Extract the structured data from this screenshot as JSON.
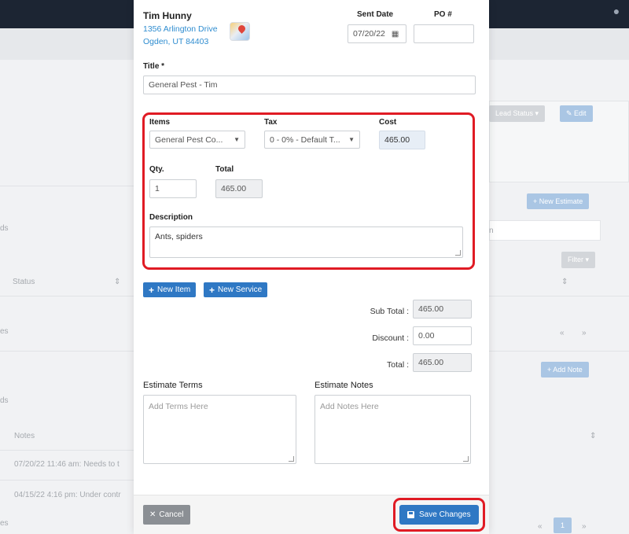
{
  "background": {
    "status_button": "Lead Status",
    "edit_button": "Edit",
    "new_estimate_button": "New Estimate",
    "filter_button": "Filter",
    "add_note_button": "Add Note",
    "status_column": "Status",
    "notes_column": "Notes",
    "note_1": "07/20/22 11:46 am: Needs to t",
    "note_2": "04/15/22 4:16 pm: Under contr",
    "page_number": "1",
    "partial_labels": [
      "ds",
      "es",
      "ds",
      "es",
      "n"
    ]
  },
  "customer": {
    "name": "Tim Hunny",
    "address_line1": "1356 Arlington Drive",
    "address_line2": "Ogden, UT 84403"
  },
  "sent_date": {
    "label": "Sent Date",
    "value": "07/20/22"
  },
  "po": {
    "label": "PO #",
    "value": ""
  },
  "title": {
    "label": "Title *",
    "value": "General Pest - Tim"
  },
  "item": {
    "items_label": "Items",
    "items_value": "General Pest Co...",
    "tax_label": "Tax",
    "tax_value": "0 - 0% - Default T...",
    "cost_label": "Cost",
    "cost_value": "465.00",
    "qty_label": "Qty.",
    "qty_value": "1",
    "total_label": "Total",
    "total_value": "465.00",
    "description_label": "Description",
    "description_value": "Ants, spiders"
  },
  "buttons": {
    "new_item": "New Item",
    "new_service": "New Service",
    "cancel": "Cancel",
    "save": "Save Changes"
  },
  "summary": {
    "subtotal_label": "Sub Total :",
    "subtotal_value": "465.00",
    "discount_label": "Discount :",
    "discount_value": "0.00",
    "total_label": "Total :",
    "total_value": "465.00"
  },
  "terms": {
    "label": "Estimate Terms",
    "placeholder": "Add Terms Here"
  },
  "notes": {
    "label": "Estimate Notes",
    "placeholder": "Add Notes Here"
  },
  "colors": {
    "primary": "#2f78c4",
    "highlight": "#e01b24",
    "link": "#2f8dd0"
  }
}
